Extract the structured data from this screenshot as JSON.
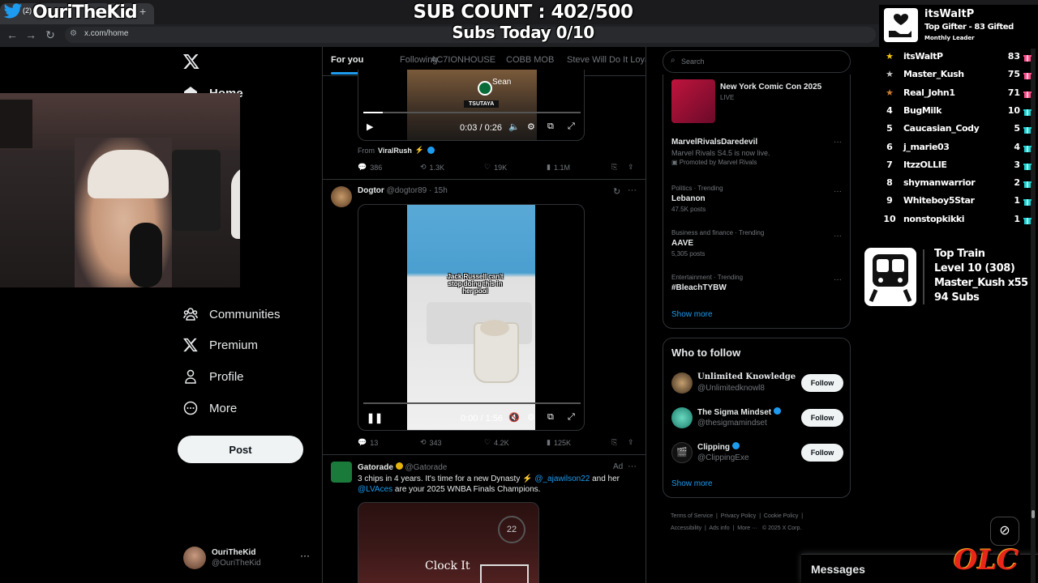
{
  "overlay": {
    "channel_name": "OuriTheKid",
    "tab_prefix": "(2)",
    "sub_count": "SUB COUNT : 402/500",
    "subs_today": "Subs Today  0/10",
    "olc_logo": "OLC"
  },
  "browser": {
    "url": "x.com/home"
  },
  "sidebar": {
    "items": [
      {
        "label": "Home",
        "icon": "home-icon"
      },
      {
        "label": "Communities",
        "icon": "communities-icon"
      },
      {
        "label": "Premium",
        "icon": "x-logo-icon"
      },
      {
        "label": "Profile",
        "icon": "profile-icon"
      },
      {
        "label": "More",
        "icon": "more-circle-icon"
      }
    ],
    "post_label": "Post",
    "account_name": "OuriTheKid",
    "account_handle": "@OuriTheKid"
  },
  "feed": {
    "tabs": [
      "For you",
      "Following",
      "AC7IONHOUSE",
      "COBB MOB",
      "Steve Will Do It Loyal"
    ],
    "post1": {
      "video_caption_overlay": "Sean",
      "video_sign": "TSUTAYA",
      "time": "0:03 / 0:26",
      "from_label": "From",
      "from_name": "ViralRush",
      "replies": "386",
      "reposts": "1.3K",
      "likes": "19K",
      "views": "1.1M"
    },
    "post2": {
      "name": "Dogtor",
      "handle": "@dogtor89 · 15h",
      "video_caption": "Jack Russell can't stop doing this in her pool",
      "time": "0:00 / 1:56",
      "replies": "13",
      "reposts": "343",
      "likes": "4.2K",
      "views": "125K"
    },
    "post3": {
      "name": "Gatorade",
      "handle": "@Gatorade",
      "ad_label": "Ad",
      "text_pre": "3 chips in 4 years. It's time for a new Dynasty ⚡",
      "mention1": "@_ajawilson22",
      "text_mid": "and her",
      "mention2": "@LVAces",
      "text_post": "are your 2025 WNBA Finals Champions.",
      "video_text": "Clock It",
      "shot_clock": "22"
    }
  },
  "right": {
    "search_placeholder": "Search",
    "event": {
      "title": "New York Comic Con 2025",
      "status": "LIVE"
    },
    "trends": [
      {
        "category": "",
        "title": "MarvelRivalsDaredevil",
        "sub": "Marvel Rivals S4.5 is now live.",
        "promo": "Promoted by Marvel Rivals"
      },
      {
        "category": "Politics · Trending",
        "title": "Lebanon",
        "sub": "47.5K posts"
      },
      {
        "category": "Business and finance · Trending",
        "title": "AAVE",
        "sub": "5,305 posts"
      },
      {
        "category": "Entertainment · Trending",
        "title": "#BleachTYBW",
        "sub": ""
      }
    ],
    "show_more": "Show more",
    "who_to_follow": {
      "title": "Who to follow",
      "users": [
        {
          "name": "Unlimited Knowledge",
          "handle": "@Unlimitedknowl8",
          "button": "Follow"
        },
        {
          "name": "The Sigma Mindset",
          "handle": "@thesigmamindset",
          "button": "Follow"
        },
        {
          "name": "Clipping",
          "handle": "@ClippingExe",
          "button": "Follow"
        }
      ],
      "show_more": "Show more"
    },
    "footer": [
      "Terms of Service",
      "Privacy Policy",
      "Cookie Policy",
      "Accessibility",
      "Ads info",
      "More ···",
      "© 2025 X Corp."
    ],
    "messages": "Messages"
  },
  "leaderboard": {
    "top_gifter": {
      "name": "itsWaltP",
      "line1": "Top Gifter - 83 Gifted",
      "line2": "Monthly Leader"
    },
    "rows": [
      {
        "rank": "★",
        "name": "itsWaltP",
        "count": "83",
        "rank_color": "#f5c518"
      },
      {
        "rank": "★",
        "name": "Master_Kush",
        "count": "75",
        "rank_color": "#c0c0c0"
      },
      {
        "rank": "★",
        "name": "Real_John1",
        "count": "71",
        "rank_color": "#cd7f32"
      },
      {
        "rank": "4",
        "name": "BugMilk",
        "count": "10"
      },
      {
        "rank": "5",
        "name": "Caucasian_Cody",
        "count": "5"
      },
      {
        "rank": "6",
        "name": "j_marie03",
        "count": "4"
      },
      {
        "rank": "7",
        "name": "ItzzOLLIE",
        "count": "3"
      },
      {
        "rank": "8",
        "name": "shymanwarrior",
        "count": "2"
      },
      {
        "rank": "9",
        "name": "Whiteboy5Star",
        "count": "1"
      },
      {
        "rank": "10",
        "name": "nonstopkikki",
        "count": "1"
      }
    ],
    "train": {
      "title": "Top Train",
      "level": "Level 10  (308)",
      "leader": "Master_Kush x55",
      "subs": "94 Subs"
    }
  },
  "colors": {
    "accent": "#1d9bf0",
    "gift_pink": "#ff4d8a",
    "gift_teal": "#19d3d3",
    "bg": "#000000"
  }
}
